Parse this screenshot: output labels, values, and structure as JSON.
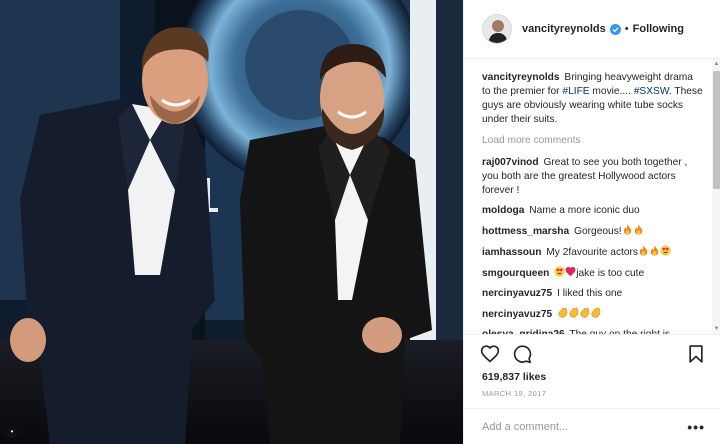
{
  "header": {
    "username": "vancityreynolds",
    "separator": "•",
    "follow_status": "Following"
  },
  "caption": {
    "username": "vancityreynolds",
    "text_before": " Bringing heavyweight drama to the premier for ",
    "hashtag1": "#LIFE",
    "text_middle": " movie.... ",
    "hashtag2": "#SXSW",
    "text_after": ". These guys are obviously wearing white tube socks under their suits."
  },
  "load_more_label": "Load more comments",
  "comments": [
    {
      "username": "raj007vinod",
      "text": "Great to see you both together , you both are the greatest Hollywood actors forever !",
      "emojis": []
    },
    {
      "username": "moldoga",
      "text": "Name a more iconic duo",
      "emojis": []
    },
    {
      "username": "hottmess_marsha",
      "text": "Gorgeous!",
      "emojis": [
        "fire",
        "fire"
      ]
    },
    {
      "username": "iamhassoun",
      "text": "My 2favourite actors",
      "emojis": [
        "fire",
        "fire",
        "heart-eyes"
      ]
    },
    {
      "username": "smgourqueen",
      "text": "jake is too cute",
      "emojis": [
        "heart-eyes",
        "heart"
      ],
      "emoji_first": true
    },
    {
      "username": "nercinyavuz75",
      "text": "I liked this one",
      "emojis": []
    },
    {
      "username": "nercinyavuz75",
      "text": "",
      "emojis": [
        "clap",
        "clap",
        "clap",
        "clap"
      ]
    },
    {
      "username": "olesya_gridina26",
      "text": "The guy on the right is following me in almost every movie I am",
      "emojis": []
    }
  ],
  "actions": {
    "likes": "619,837 likes",
    "date": "MARCH 19, 2017",
    "comment_placeholder": "Add a comment...",
    "more_label": "•••"
  },
  "icons": [
    "heart-icon",
    "comment-icon",
    "bookmark-icon",
    "verified-badge-icon",
    "fire-emoji",
    "heart-eyes-emoji",
    "heart-emoji",
    "clap-emoji"
  ],
  "colors": {
    "link": "#003569",
    "muted": "#999999",
    "verified": "#3897f0",
    "text": "#262626"
  }
}
